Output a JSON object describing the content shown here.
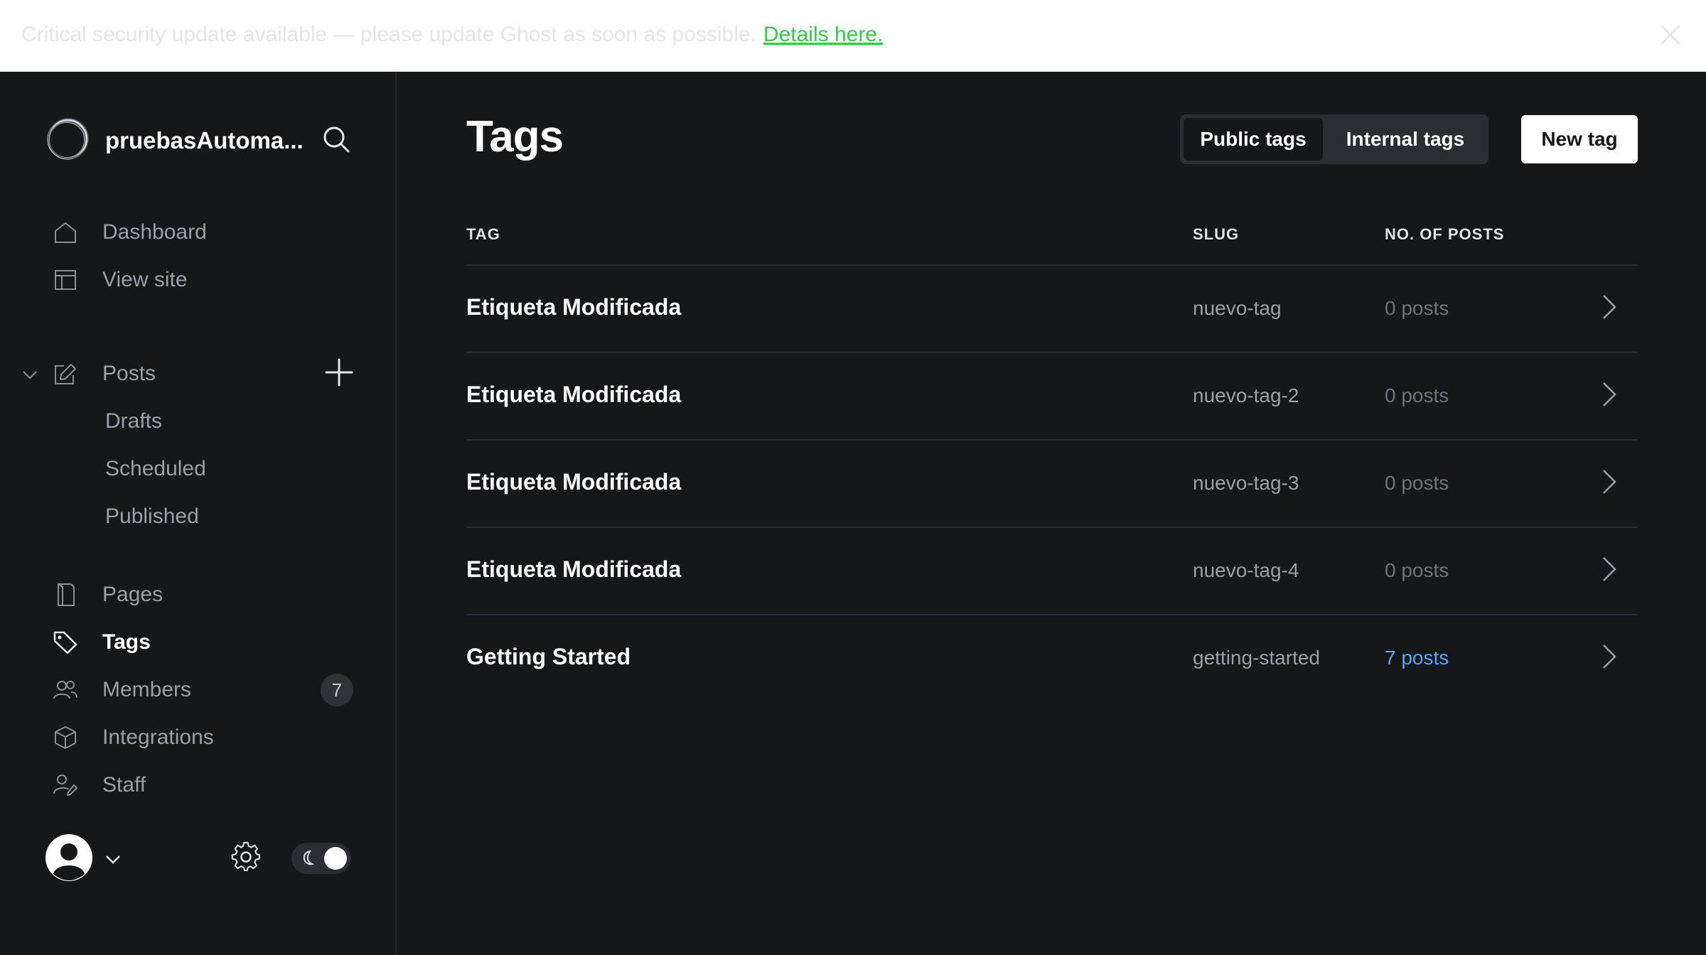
{
  "banner": {
    "message": "Critical security update available — please update Ghost as soon as possible.",
    "link_text": "Details here."
  },
  "sidebar": {
    "site_title": "pruebasAutoma...",
    "nav": [
      {
        "label": "Dashboard",
        "icon": "home-icon"
      },
      {
        "label": "View site",
        "icon": "layout-icon"
      }
    ],
    "posts": {
      "label": "Posts",
      "icon": "edit-icon",
      "sub_items": [
        "Drafts",
        "Scheduled",
        "Published"
      ]
    },
    "nav2": [
      {
        "label": "Pages",
        "icon": "page-icon"
      },
      {
        "label": "Tags",
        "icon": "tag-icon",
        "active": true
      },
      {
        "label": "Members",
        "icon": "members-icon",
        "count": "7"
      },
      {
        "label": "Integrations",
        "icon": "cube-icon"
      },
      {
        "label": "Staff",
        "icon": "staff-icon"
      }
    ]
  },
  "main": {
    "title": "Tags",
    "segments": {
      "public": "Public tags",
      "internal": "Internal tags",
      "active": "public"
    },
    "new_button": "New tag",
    "columns": {
      "tag": "TAG",
      "slug": "SLUG",
      "posts": "NO. OF POSTS"
    },
    "rows": [
      {
        "name": "Etiqueta Modificada",
        "slug": "nuevo-tag",
        "posts": "0 posts"
      },
      {
        "name": "Etiqueta Modificada",
        "slug": "nuevo-tag-2",
        "posts": "0 posts"
      },
      {
        "name": "Etiqueta Modificada",
        "slug": "nuevo-tag-3",
        "posts": "0 posts"
      },
      {
        "name": "Etiqueta Modificada",
        "slug": "nuevo-tag-4",
        "posts": "0 posts"
      },
      {
        "name": "Getting Started",
        "slug": "getting-started",
        "posts": "7 posts"
      }
    ]
  },
  "colors": {
    "background": "#151719",
    "accent_link": "#55a6f5",
    "banner_link": "#30cf43"
  }
}
